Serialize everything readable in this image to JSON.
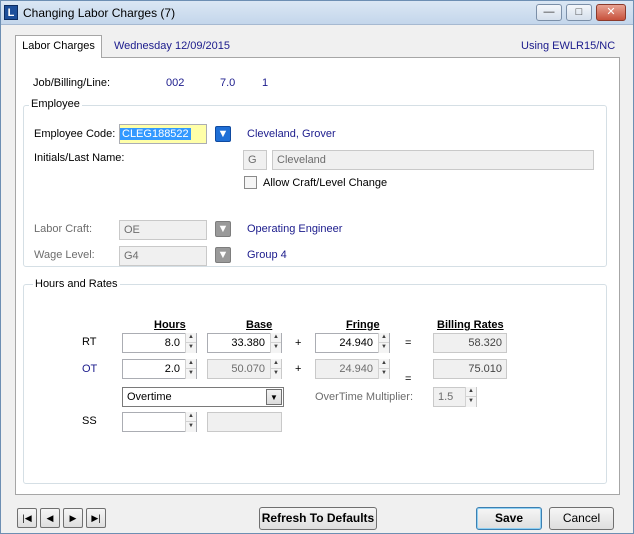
{
  "window": {
    "title": "Changing Labor Charges  (7)",
    "app_icon_letter": "L",
    "minimize": "—",
    "maximize": "□",
    "close": "✕"
  },
  "tabs": [
    {
      "label": "Labor Charges",
      "active": true
    }
  ],
  "header": {
    "date": "Wednesday 12/09/2015",
    "using": "Using EWLR15/NC"
  },
  "job": {
    "label": "Job/Billing/Line:",
    "job": "002",
    "billing": "7.0",
    "line": "1"
  },
  "employee": {
    "group_label": "Employee",
    "code_label": "Employee Code:",
    "code_value": "CLEG188522",
    "name": "Cleveland, Grover",
    "initials_label": "Initials/Last Name:",
    "initials_value": "G",
    "last_name_value": "Cleveland",
    "allow_change_label": "Allow Craft/Level Change",
    "allow_change_checked": false,
    "craft_label": "Labor Craft:",
    "craft_value": "OE",
    "craft_desc": "Operating Engineer",
    "wage_label": "Wage Level:",
    "wage_value": "G4",
    "wage_desc": "Group 4"
  },
  "hours_rates": {
    "group_label": "Hours and Rates",
    "headers": {
      "hours": "Hours",
      "base": "Base",
      "fringe": "Fringe",
      "billing": "Billing Rates"
    },
    "rows": [
      {
        "label": "RT",
        "hours": "8.0",
        "base": "33.380",
        "plus": "+",
        "fringe": "24.940",
        "equals": "=",
        "billing": "58.320"
      },
      {
        "label": "OT",
        "hours": "2.0",
        "base": "50.070",
        "plus": "+",
        "fringe": "24.940",
        "equals": "=",
        "billing": "75.010"
      },
      {
        "label": "SS",
        "hours": "",
        "base": ""
      }
    ],
    "ot_type": "Overtime",
    "ot_multiplier_label": "OverTime Multiplier:",
    "ot_multiplier_value": "1.5"
  },
  "footer": {
    "first": "|◀",
    "prev": "◀",
    "next": "▶",
    "last": "▶|",
    "refresh": "Refresh To Defaults",
    "save": "Save",
    "cancel": "Cancel"
  }
}
